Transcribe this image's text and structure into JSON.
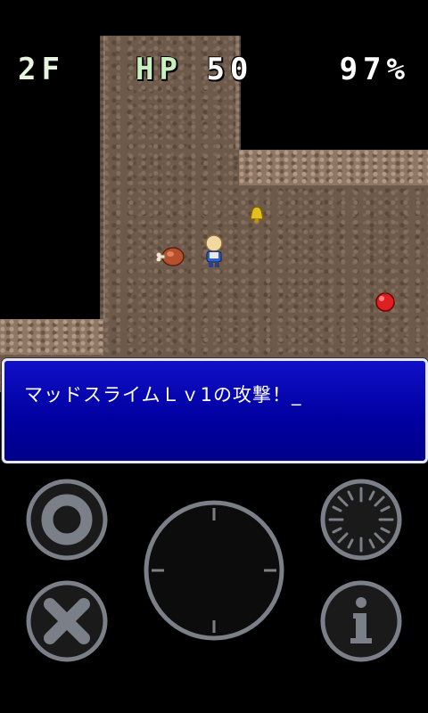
{
  "hud": {
    "floor": "2F",
    "hp_label": "HP",
    "hp_value": "50",
    "satiety": "97%"
  },
  "message": {
    "text": "マッドスライムＬｖ1の攻撃！_"
  },
  "colors": {
    "floor": "#6e5a4a",
    "message_bg": "#0000a0",
    "button_outline": "#7a7f88"
  },
  "icons": {
    "confirm": "circle-ring-icon",
    "cancel": "x-icon",
    "dpad": "dpad-circle-icon",
    "menu": "clock-dial-icon",
    "info": "info-icon"
  }
}
